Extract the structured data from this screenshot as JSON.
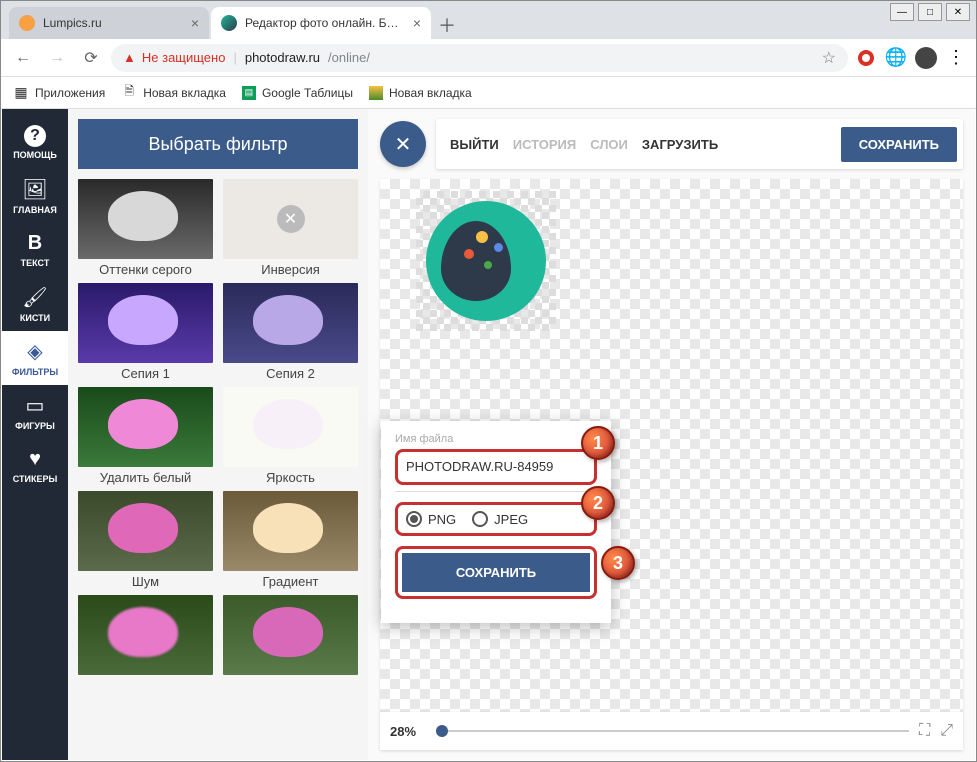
{
  "browser": {
    "tabs": [
      {
        "title": "Lumpics.ru",
        "favicon_color": "#f7a044"
      },
      {
        "title": "Редактор фото онлайн. Бесплат",
        "favicon_color": "#1fb89a"
      }
    ],
    "nav": {
      "back": "←",
      "forward": "→",
      "reload": "⟳"
    },
    "url_warning": "Не защищено",
    "url_host": "photodraw.ru",
    "url_path": "/online/",
    "bookmarks": [
      {
        "label": "Приложения",
        "icon": "apps"
      },
      {
        "label": "Новая вкладка",
        "icon": "doc"
      },
      {
        "label": "Google Таблицы",
        "icon": "sheets"
      },
      {
        "label": "Новая вкладка",
        "icon": "pic"
      }
    ]
  },
  "sidebar": [
    {
      "label": "ПОМОЩЬ",
      "icon": "?"
    },
    {
      "label": "ГЛАВНАЯ",
      "icon": "image"
    },
    {
      "label": "ТЕКСТ",
      "icon": "B"
    },
    {
      "label": "КИСТИ",
      "icon": "brush"
    },
    {
      "label": "ФИЛЬТРЫ",
      "icon": "filter",
      "active": true
    },
    {
      "label": "ФИГУРЫ",
      "icon": "shape"
    },
    {
      "label": "СТИКЕРЫ",
      "icon": "heart"
    }
  ],
  "panel_title": "Выбрать фильтр",
  "filters": [
    "Оттенки серого",
    "Инверсия",
    "Сепия 1",
    "Сепия 2",
    "Удалить белый",
    "Яркость",
    "Шум",
    "Градиент"
  ],
  "toolbar": {
    "exit": "ВЫЙТИ",
    "history": "ИСТОРИЯ",
    "layers": "СЛОИ",
    "upload": "ЗАГРУЗИТЬ",
    "save": "СОХРАНИТЬ"
  },
  "save_popup": {
    "filename_label": "Имя файла",
    "filename_value": "PHOTODRAW.RU-84959",
    "format_png": "PNG",
    "format_jpeg": "JPEG",
    "save_button": "СОХРАНИТЬ"
  },
  "zoom_value": "28%",
  "markers": {
    "m1": "1",
    "m2": "2",
    "m3": "3"
  },
  "filter_colors": {
    "gray": {
      "bg": "#5a5a5a",
      "petal": "#d0d0d0"
    },
    "inv": {
      "bg": "#e4e4e4",
      "petal": "#c4c4c4"
    },
    "sepia1": {
      "bg": "#4a2a8a",
      "petal": "#b088ff"
    },
    "sepia2": {
      "bg": "#3a2a6a",
      "petal": "#a898d8"
    },
    "delwhite": {
      "bg": "#2a5a2a",
      "petal": "#e878c8"
    },
    "bright": {
      "bg": "#f8f8f0",
      "petal": "#f8e8f8"
    },
    "noise": {
      "bg": "#4a5a3a",
      "petal": "#d858a8"
    },
    "gradient": {
      "bg": "#8a7a5a",
      "petal": "#f0d8a8"
    },
    "extra1": {
      "bg": "#3a5a2a",
      "petal": "#e878c8"
    },
    "extra2": {
      "bg": "#4a6a3a",
      "petal": "#d858a8"
    }
  }
}
